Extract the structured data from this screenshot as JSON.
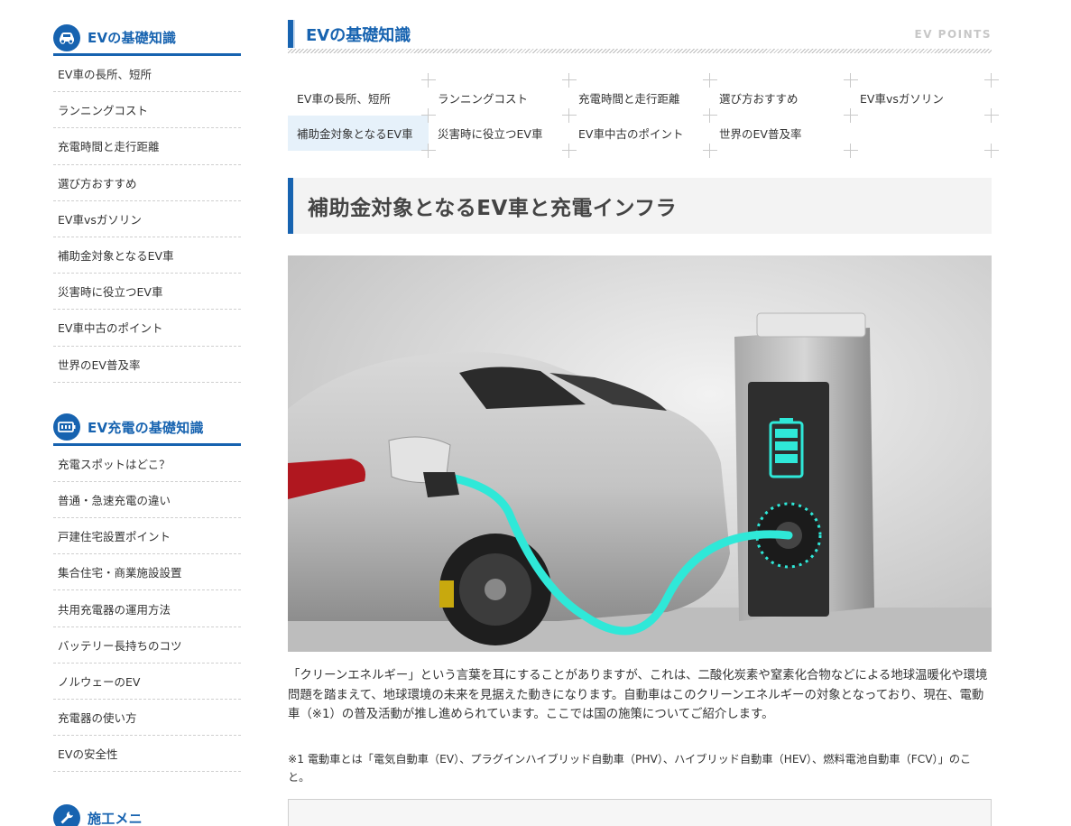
{
  "sidebar": {
    "group1": {
      "title": "EVの基礎知識",
      "icon": "car-icon",
      "items": [
        "EV車の長所、短所",
        "ランニングコスト",
        "充電時間と走行距離",
        "選び方おすすめ",
        "EV車vsガソリン",
        "補助金対象となるEV車",
        "災害時に役立つEV車",
        "EV車中古のポイント",
        "世界のEV普及率"
      ]
    },
    "group2": {
      "title": "EV充電の基礎知識",
      "icon": "battery-icon",
      "items": [
        "充電スポットはどこ？",
        "普通・急速充電の違い",
        "戸建住宅設置ポイント",
        "集合住宅・商業施設設置",
        "共用充電器の運用方法",
        "バッテリー長持ちのコツ",
        "ノルウェーのEV",
        "充電器の使い方",
        "EVの安全性"
      ]
    },
    "group3": {
      "title": "施工メニ",
      "icon": "wrench-icon"
    }
  },
  "main": {
    "title": "EVの基礎知識",
    "subtitle": "EV POINTS",
    "tabs": [
      "EV車の長所、短所",
      "ランニングコスト",
      "充電時間と走行距離",
      "選び方おすすめ",
      "EV車vsガソリン",
      "補助金対象となるEV車",
      "災害時に役立つEV車",
      "EV車中古のポイント",
      "世界のEV普及率"
    ],
    "active_tab": "補助金対象となるEV車",
    "section_title": "補助金対象となるEV車と充電インフラ",
    "paragraph": "「クリーンエネルギー」という言葉を耳にすることがありますが、これは、二酸化炭素や窒素化合物などによる地球温暖化や環境問題を踏まえて、地球環境の未来を見据えた動きになります。自動車はこのクリーンエネルギーの対象となっており、現在、電動車（※1）の普及活動が推し進められています。ここでは国の施策についてご紹介します。",
    "note": "※1 電動車とは「電気自動車（EV）、プラグインハイブリッド自動車（PHV）、ハイブリッド自動車（HEV）、燃料電池自動車（FCV）」のこと。"
  },
  "colors": {
    "brand_blue": "#1763b0",
    "active_tab_bg": "#e6f1fa",
    "cable_cyan": "#2fe8d8"
  }
}
